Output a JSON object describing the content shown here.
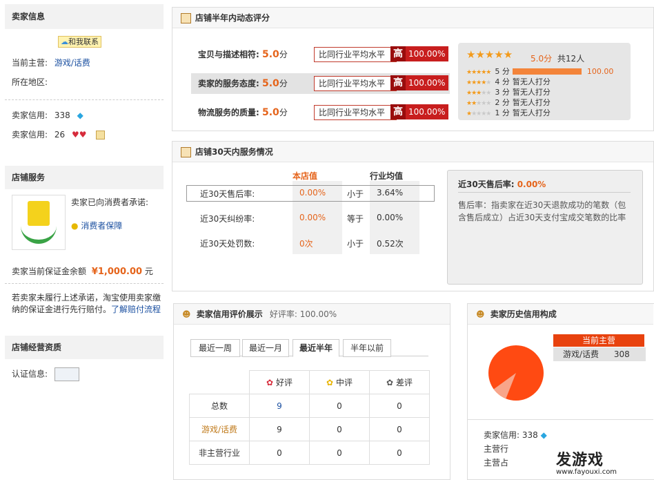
{
  "seller": {
    "title": "卖家信息",
    "contact": "和我联系",
    "main_label": "当前主营:",
    "main_value": "游戏/话费",
    "region_label": "所在地区:",
    "credit1_label": "卖家信用:",
    "credit1_value": "338",
    "credit2_label": "卖家信用:",
    "credit2_value": "26"
  },
  "shop_service": {
    "title": "店铺服务",
    "promise": "卖家已向消费者承诺:",
    "guarantee": "消费者保障",
    "deposit_label": "卖家当前保证金余额",
    "deposit_value": "¥1,000.00",
    "deposit_unit": "元",
    "note": "若卖家未履行上述承诺，淘宝使用卖家缴纳的保证金进行先行赔付。",
    "note_link": "了解赔付流程"
  },
  "qualification": {
    "title": "店铺经营资质",
    "cert_label": "认证信息:"
  },
  "dsr": {
    "title": "店铺半年内动态评分",
    "rows": [
      {
        "label": "宝贝与描述相符:",
        "score": "5.0",
        "unit": "分",
        "compare": "比同行业平均水平",
        "high": "高",
        "pct": "100.00%"
      },
      {
        "label": "卖家的服务态度:",
        "score": "5.0",
        "unit": "分",
        "compare": "比同行业平均水平",
        "high": "高",
        "pct": "100.00%"
      },
      {
        "label": "物流服务的质量:",
        "score": "5.0",
        "unit": "分",
        "compare": "比同行业平均水平",
        "high": "高",
        "pct": "100.00%"
      }
    ],
    "summary_score": "5.0分",
    "summary_count": "共12人",
    "dist": [
      {
        "label": "5 分",
        "value": "100.00",
        "fraction": 1.0
      },
      {
        "label": "4 分",
        "value": "暂无人打分",
        "fraction": 0
      },
      {
        "label": "3 分",
        "value": "暂无人打分",
        "fraction": 0
      },
      {
        "label": "2 分",
        "value": "暂无人打分",
        "fraction": 0
      },
      {
        "label": "1 分",
        "value": "暂无人打分",
        "fraction": 0
      }
    ]
  },
  "service30": {
    "title": "店铺30天内服务情况",
    "col_shop": "本店值",
    "col_industry": "行业均值",
    "rows": [
      {
        "label": "近30天售后率:",
        "shop": "0.00%",
        "cmp": "小于",
        "avg": "3.64%"
      },
      {
        "label": "近30天纠纷率:",
        "shop": "0.00%",
        "cmp": "等于",
        "avg": "0.00%"
      },
      {
        "label": "近30天处罚数:",
        "shop": "0次",
        "cmp": "小于",
        "avg": "0.52次"
      }
    ],
    "detail_title": "近30天售后率:",
    "detail_value": "0.00%",
    "detail_text": "售后率：指卖家在近30天退款成功的笔数（包含售后成立）占近30天支付宝成交笔数的比率"
  },
  "credit_show": {
    "title": "卖家信用评价展示",
    "rate_label": "好评率: 100.00%",
    "tabs": [
      "最近一周",
      "最近一月",
      "最近半年",
      "半年以前"
    ],
    "headers": [
      "好评",
      "中评",
      "差评"
    ],
    "rows": [
      {
        "label": "总数",
        "good": "9",
        "mid": "0",
        "bad": "0"
      },
      {
        "label": "游戏/话费",
        "good": "9",
        "mid": "0",
        "bad": "0"
      },
      {
        "label": "非主营行业",
        "good": "0",
        "mid": "0",
        "bad": "0"
      }
    ]
  },
  "history": {
    "title": "卖家历史信用构成",
    "main_tag": "当前主营",
    "cat_name": "游戏/话费",
    "cat_value": "308",
    "credit_label": "卖家信用:",
    "credit_value": "338",
    "line2": "主营行",
    "line3": "主营占",
    "colors": {
      "main": "#ff4a12",
      "other": "#f8a58a"
    },
    "share_main": 0.91
  },
  "watermark": {
    "brand": "发游戏",
    "url": "www.fayouxi.com"
  }
}
